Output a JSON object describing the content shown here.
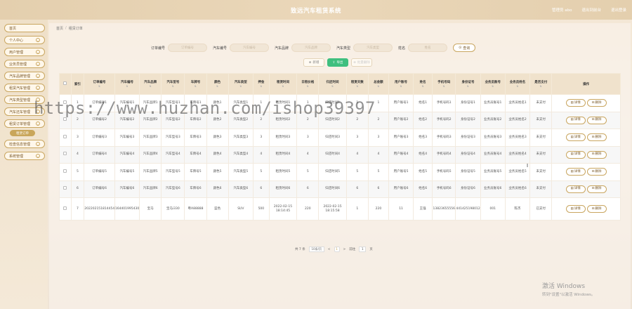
{
  "header": {
    "title": "致远汽车租赁系统",
    "links": [
      "管理员 abo",
      "退出到前台",
      "退出登录"
    ]
  },
  "sidebar": {
    "items": [
      {
        "label": "首页",
        "has_children": false
      },
      {
        "label": "个人中心",
        "has_children": true
      },
      {
        "label": "用户管理",
        "has_children": true
      },
      {
        "label": "业务员管理",
        "has_children": true
      },
      {
        "label": "汽车品牌管理",
        "has_children": true
      },
      {
        "label": "租赁汽车管理",
        "has_children": true
      },
      {
        "label": "汽车类型管理",
        "has_children": true
      },
      {
        "label": "汽车还车管理",
        "has_children": true
      },
      {
        "label": "租赁订单管理",
        "has_children": true
      }
    ],
    "active_sub": "租赁订单",
    "items_after": [
      {
        "label": "检查信息管理",
        "has_children": true
      },
      {
        "label": "系统管理",
        "has_children": true
      }
    ]
  },
  "breadcrumb": {
    "home": "首页",
    "sep": "/",
    "current": "租赁订单"
  },
  "search": {
    "fields": [
      {
        "label": "订单编号",
        "placeholder": "订单编号"
      },
      {
        "label": "汽车编号",
        "placeholder": "汽车编号"
      },
      {
        "label": "汽车品牌",
        "placeholder": "汽车品牌"
      },
      {
        "label": "汽车类型",
        "placeholder": "汽车类型"
      },
      {
        "label": "姓名",
        "placeholder": "姓名"
      }
    ],
    "query_icon": "search-icon",
    "query_label": "查询"
  },
  "actions": {
    "add_label": "新增",
    "export_label": "导出",
    "delete_label": "批量删除"
  },
  "table": {
    "headers": [
      "",
      "索引",
      "订单编号",
      "汽车编号",
      "汽车品牌",
      "汽车型号",
      "车牌号",
      "颜色",
      "汽车类型",
      "押金",
      "租赁时间",
      "日租价格",
      "归还时间",
      "租赁天数",
      "总金额",
      "用户账号",
      "姓名",
      "手机号码",
      "身份证号",
      "业务员账号",
      "业务员姓名",
      "是否支付",
      "操作"
    ],
    "rows": [
      [
        "1",
        "订单编号1",
        "汽车编号1",
        "汽车品牌1",
        "汽车型号1",
        "车牌号1",
        "颜色1",
        "汽车类型1",
        "1",
        "租赁时间1",
        "1",
        "归还时间1",
        "1",
        "1",
        "用户账号1",
        "姓名1",
        "手机号码1",
        "身份证号1",
        "业务员账号1",
        "业务员姓名1",
        "未支付"
      ],
      [
        "2",
        "订单编号2",
        "汽车编号2",
        "汽车品牌2",
        "汽车型号2",
        "车牌号2",
        "颜色2",
        "汽车类型2",
        "2",
        "租赁时间2",
        "2",
        "归还时间2",
        "2",
        "2",
        "用户账号2",
        "姓名2",
        "手机号码2",
        "身份证号2",
        "业务员账号2",
        "业务员姓名2",
        "未支付"
      ],
      [
        "3",
        "订单编号3",
        "汽车编号3",
        "汽车品牌3",
        "汽车型号3",
        "车牌号3",
        "颜色3",
        "汽车类型3",
        "3",
        "租赁时间3",
        "3",
        "归还时间3",
        "3",
        "3",
        "用户账号3",
        "姓名3",
        "手机号码3",
        "身份证号3",
        "业务员账号3",
        "业务员姓名3",
        "未支付"
      ],
      [
        "4",
        "订单编号4",
        "汽车编号4",
        "汽车品牌4",
        "汽车型号4",
        "车牌号4",
        "颜色4",
        "汽车类型4",
        "4",
        "租赁时间4",
        "4",
        "归还时间4",
        "4",
        "4",
        "用户账号4",
        "姓名4",
        "手机号码4",
        "身份证号4",
        "业务员账号4",
        "业务员姓名4",
        "未支付"
      ],
      [
        "5",
        "订单编号5",
        "汽车编号5",
        "汽车品牌5",
        "汽车型号5",
        "车牌号5",
        "颜色5",
        "汽车类型5",
        "5",
        "租赁时间5",
        "5",
        "归还时间5",
        "5",
        "5",
        "用户账号5",
        "姓名5",
        "手机号码5",
        "身份证号5",
        "业务员账号5",
        "业务员姓名5",
        "未支付"
      ],
      [
        "6",
        "订单编号6",
        "汽车编号6",
        "汽车品牌6",
        "汽车型号6",
        "车牌号6",
        "颜色6",
        "汽车类型6",
        "6",
        "租赁时间6",
        "6",
        "归还时间6",
        "6",
        "6",
        "用户账号6",
        "姓名6",
        "手机号码6",
        "身份证号6",
        "业务员账号6",
        "业务员姓名6",
        "未支付"
      ],
      [
        "7",
        "2022021518144540592841",
        "1644019954308",
        "宝马",
        "宝马i330",
        "粤A88888",
        "蓝色",
        "SUV",
        "500",
        "2022-02-15 18:14:45",
        "220",
        "2022-02-15 18:15:58",
        "1",
        "220",
        "11",
        "王强",
        "13823655556",
        "441425198012235566",
        "001",
        "陈杰",
        "已支付"
      ]
    ],
    "detail_label": "详情",
    "delete_label": "删除"
  },
  "pagination": {
    "total_text": "共 7 条",
    "page_size": "10条/页",
    "prev": "<",
    "current_page": "1",
    "next": ">",
    "goto_label": "前往",
    "goto_value": "1",
    "page_unit": "页"
  },
  "watermark_url": "https://www.huzhan.com/ishop39397",
  "windows_watermark": {
    "line1": "激活 Windows",
    "line2": "转到\"设置\"以激活 Windows。"
  }
}
